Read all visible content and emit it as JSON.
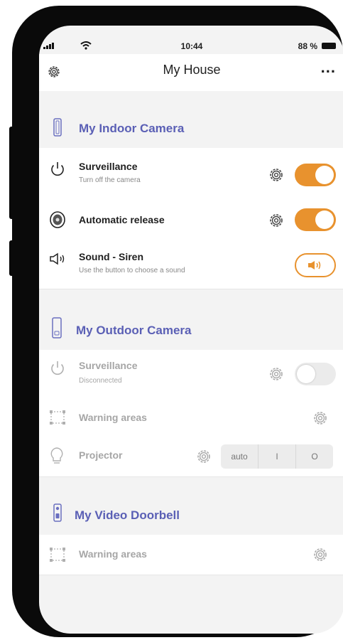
{
  "status_bar": {
    "time": "10:44",
    "battery_percent": "88 %"
  },
  "header": {
    "title": "My House",
    "more_label": "..."
  },
  "sections": [
    {
      "title": "My Indoor Camera",
      "rows": [
        {
          "title": "Surveillance",
          "subtitle": "Turn off the camera",
          "toggle_on": true
        },
        {
          "title": "Automatic release",
          "toggle_on": true
        },
        {
          "title": "Sound - Siren",
          "subtitle": "Use the button to choose a sound"
        }
      ]
    },
    {
      "title": "My Outdoor Camera",
      "rows": [
        {
          "title": "Surveillance",
          "subtitle": "Disconnected",
          "toggle_on": false
        },
        {
          "title": "Warning areas"
        },
        {
          "title": "Projector",
          "options": [
            "auto",
            "I",
            "O"
          ]
        }
      ]
    },
    {
      "title": "My Video Doorbell",
      "rows": [
        {
          "title": "Warning areas"
        }
      ]
    }
  ],
  "colors": {
    "accent": "#e8922e",
    "section_title": "#5a5fb5",
    "disabled_text": "#a6a6a6"
  }
}
